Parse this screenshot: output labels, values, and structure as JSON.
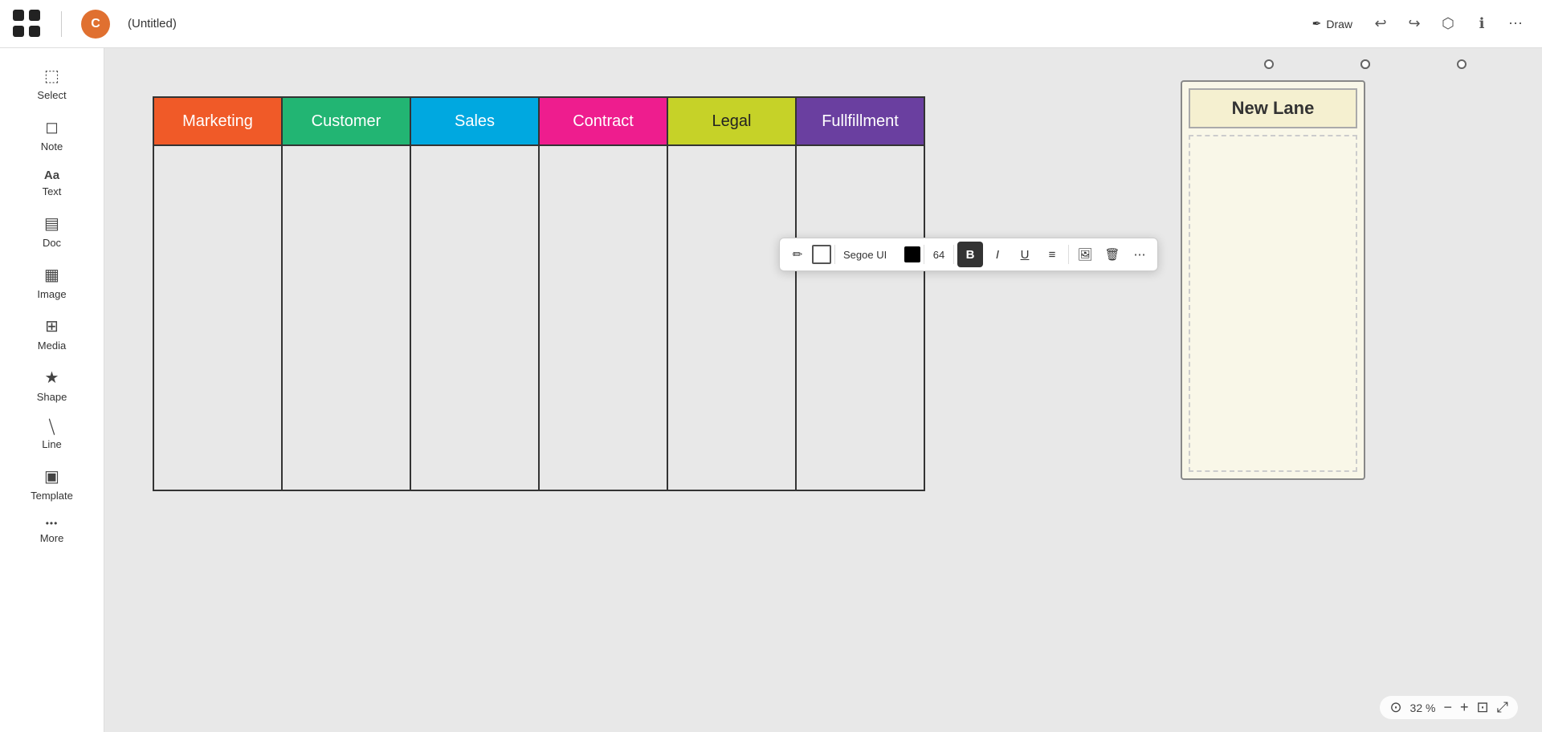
{
  "topbar": {
    "logo_alt": "App Logo",
    "avatar_initial": "C",
    "doc_title": "(Untitled)",
    "draw_label": "Draw",
    "undo_label": "↩",
    "redo_label": "↪",
    "share_label": "Share",
    "info_label": "Info",
    "more_label": "⋯"
  },
  "sidebar": {
    "items": [
      {
        "id": "select",
        "label": "Select",
        "icon": "⬚"
      },
      {
        "id": "note",
        "label": "Note",
        "icon": "◻"
      },
      {
        "id": "text",
        "label": "Text",
        "icon": "Aa"
      },
      {
        "id": "doc",
        "label": "Doc",
        "icon": "▤"
      },
      {
        "id": "image",
        "label": "Image",
        "icon": "▦"
      },
      {
        "id": "media",
        "label": "Media",
        "icon": "⊞"
      },
      {
        "id": "shape",
        "label": "Shape",
        "icon": "★"
      },
      {
        "id": "line",
        "label": "Line",
        "icon": "╱"
      },
      {
        "id": "template",
        "label": "Template",
        "icon": "▣"
      },
      {
        "id": "more",
        "label": "More",
        "icon": "•••"
      }
    ]
  },
  "swimlane": {
    "columns": [
      {
        "id": "marketing",
        "label": "Marketing",
        "color": "#f05a28",
        "text_color": "#fff"
      },
      {
        "id": "customer",
        "label": "Customer",
        "color": "#22b573",
        "text_color": "#fff"
      },
      {
        "id": "sales",
        "label": "Sales",
        "color": "#00a8e0",
        "text_color": "#fff"
      },
      {
        "id": "contract",
        "label": "Contract",
        "color": "#ee1d8e",
        "text_color": "#fff"
      },
      {
        "id": "legal",
        "label": "Legal",
        "color": "#c6d228",
        "text_color": "#222"
      },
      {
        "id": "fulfillment",
        "label": "Fullfillment",
        "color": "#6a3fa0",
        "text_color": "#fff"
      }
    ]
  },
  "new_lane": {
    "title": "New Lane",
    "background": "#f9f7e8",
    "header_bg": "#f5f0d0"
  },
  "format_toolbar": {
    "pencil_icon": "✏",
    "outline_icon": "□",
    "font_name": "Segoe UI",
    "font_size": "64",
    "bold_label": "B",
    "italic_label": "I",
    "underline_label": "U",
    "align_label": "≡",
    "image_label": "🖼",
    "delete_label": "🗑",
    "more_label": "⋯"
  },
  "zoom": {
    "percent": "32 %",
    "zoom_out_icon": "−",
    "zoom_in_icon": "+",
    "fit_icon": "⊡",
    "fullscreen_icon": "⤢"
  }
}
